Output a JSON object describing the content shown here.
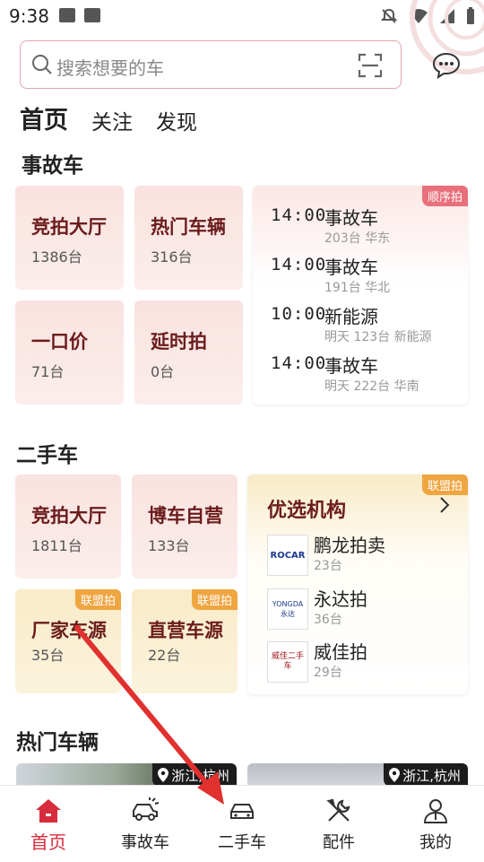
{
  "status_bar": {
    "time": "9:38"
  },
  "search": {
    "placeholder": "搜索想要的车"
  },
  "top_tabs": [
    {
      "label": "首页",
      "active": true
    },
    {
      "label": "关注",
      "active": false
    },
    {
      "label": "发现",
      "active": false
    }
  ],
  "accident_section": {
    "title": "事故车",
    "cards": [
      {
        "title": "竞拍大厅",
        "count": "1386台"
      },
      {
        "title": "热门车辆",
        "count": "316台"
      },
      {
        "title": "一口价",
        "count": "71台"
      },
      {
        "title": "延时拍",
        "count": "0台"
      }
    ],
    "schedule": {
      "badge": "顺序拍",
      "rows": [
        {
          "time": "14:00",
          "name": "事故车",
          "sub": "203台 华东"
        },
        {
          "time": "14:00",
          "name": "事故车",
          "sub": "191台 华北"
        },
        {
          "time": "10:00",
          "name": "新能源",
          "sub": "明天 123台 新能源"
        },
        {
          "time": "14:00",
          "name": "事故车",
          "sub": "明天 222台 华南"
        }
      ]
    }
  },
  "used_section": {
    "title": "二手车",
    "cards": [
      {
        "title": "竞拍大厅",
        "count": "1811台",
        "badge": ""
      },
      {
        "title": "博车自营",
        "count": "133台",
        "badge": ""
      },
      {
        "title": "厂家车源",
        "count": "35台",
        "badge": "联盟拍"
      },
      {
        "title": "直营车源",
        "count": "22台",
        "badge": "联盟拍"
      }
    ],
    "orgs": {
      "badge": "联盟拍",
      "title": "优选机构",
      "items": [
        {
          "name": "鹏龙拍卖",
          "count": "23台",
          "logo_text": "ROCAR"
        },
        {
          "name": "永达拍",
          "count": "36台",
          "logo_text": "YONGDA 永达"
        },
        {
          "name": "威佳拍",
          "count": "29台",
          "logo_text": "威佳二手车"
        }
      ]
    }
  },
  "hot_section": {
    "title": "热门车辆",
    "cards": [
      {
        "location": "浙江,杭州"
      },
      {
        "location": "浙江,杭州"
      }
    ]
  },
  "bottom_nav": [
    {
      "label": "首页",
      "icon": "home-icon",
      "active": true
    },
    {
      "label": "事故车",
      "icon": "damaged-car-icon",
      "active": false
    },
    {
      "label": "二手车",
      "icon": "car-icon",
      "active": false
    },
    {
      "label": "配件",
      "icon": "tools-icon",
      "active": false
    },
    {
      "label": "我的",
      "icon": "profile-icon",
      "active": false
    }
  ],
  "colors": {
    "brand_red": "#d72c3d",
    "card_title": "#6b1c1c",
    "badge_red": "#e9707a",
    "badge_orange": "#efa540",
    "arrow": "#e0312f"
  }
}
